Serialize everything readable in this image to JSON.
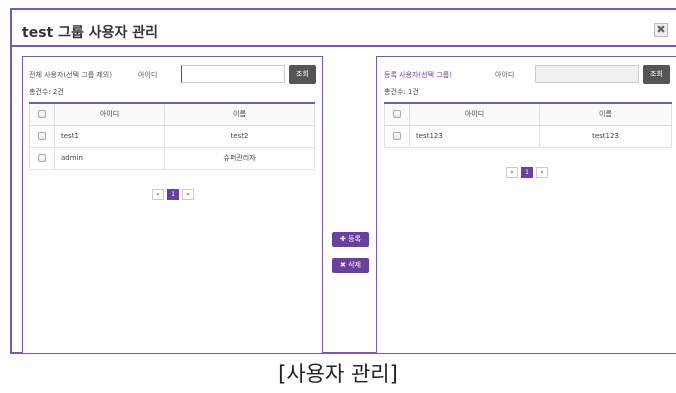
{
  "dialog": {
    "title": "test 그룹 사용자 관리",
    "close_glyph": "✖"
  },
  "left_panel": {
    "title": "전체 사용자(선택 그룹 제외)",
    "id_label": "아이디",
    "search_value": "",
    "search_button": "조회",
    "total_count": "총건수: 2건",
    "columns": [
      "아이디",
      "이름"
    ],
    "rows": [
      {
        "id": "test1",
        "name": "test2"
      },
      {
        "id": "admin",
        "name": "슈퍼관리자"
      }
    ],
    "pager": {
      "first": "«",
      "page": "1",
      "last": "»"
    }
  },
  "right_panel": {
    "title": "등록 사용자(선택 그룹)",
    "id_label": "아이디",
    "search_value": "",
    "search_button": "조회",
    "total_count": "총건수: 1건",
    "columns": [
      "아이디",
      "이름"
    ],
    "rows": [
      {
        "id": "test123",
        "name": "test123"
      }
    ],
    "pager": {
      "first": "«",
      "page": "1",
      "last": "»"
    }
  },
  "actions": {
    "register_label": "✚ 등록",
    "delete_label": "✖ 삭제"
  },
  "caption": "[사용자 관리]",
  "colors": {
    "accent": "#6b3fa0",
    "border": "#7a5ba8"
  }
}
